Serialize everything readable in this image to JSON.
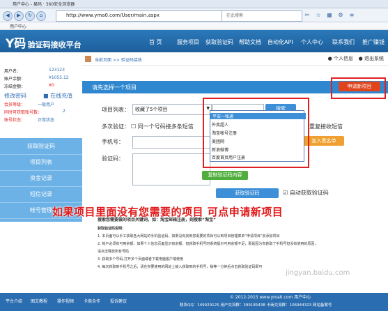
{
  "browser": {
    "tab_title": "用户中心 - 易码 · 360安全浏览器",
    "url": "http://www.yma0.com/User/main.aspx",
    "search_placeholder": "在此搜索",
    "bookmark": "用户中心"
  },
  "site": {
    "logo_main": "Y码",
    "logo_sub": "验证码接收平台",
    "nav": [
      "首 页",
      "服务项目",
      "获取验证码",
      "帮助文档",
      "自动化API",
      "个人中心",
      "联系我们",
      "推广赚钱"
    ]
  },
  "breadcrumb": {
    "text": "当前页面 >> 验证码接收",
    "userinfo": "个人信息",
    "logout": "退出系统"
  },
  "account": {
    "username_label": "用户名：",
    "username": "123123",
    "balance_label": "账户余额：",
    "balance": "¥1055.12",
    "frozen_label": "冻结金额：",
    "frozen": "¥0",
    "change_pwd": "修改密码",
    "recharge": "在线充值",
    "level_label": "会员等级：",
    "level": "一般用户",
    "concurrent_label": "同时可获取账号数：",
    "concurrent": "2",
    "status_label": "账号状态：",
    "status": "正常状态"
  },
  "sidebar_menu": [
    "获取验证码",
    "项目列表",
    "资金记录",
    "短信记录",
    "帐号管理"
  ],
  "panel": {
    "title": "请先选择一个项目",
    "apply_button": "申请新项目",
    "project_label": "项目列表：",
    "project_select": "收藏了5个项目",
    "search_button": "搜索",
    "multi_label": "多次验证：",
    "multi_text": "同一个号码接多条短信",
    "reuse_text": "重复接收短信",
    "phone_label": "手机号：",
    "blacklist_button": "加入黑名单",
    "code_label": "验证码：",
    "copy_button": "复制验证码内容",
    "get_code_button": "获取验证码",
    "auto_get_text": "自动获取验证码"
  },
  "dropdown": {
    "input_value": "",
    "items": [
      "平安一帐通",
      "外卖超人",
      "淘宝帐号注册",
      "美团网",
      "新浪微博",
      "百度首页用户注册"
    ]
  },
  "caption": "如果项目里面没有您需要的项目 可点申请新项目",
  "notes": [
    "搜索您需要做的项目关键词，如：淘宝邮箱注册，则搜索“淘宝”",
    "获取验证码说明：",
    "1. 本页面可以手工获取各大网站的手机验证码，如果没有找到您需要的项目可以到项目管理菜单“申请项目”去添加项目",
    "2. 帐户必须有可用余额，如果个人信息页面显示有余额，但获取手机号时系统提示可用余额不足，那是因为你获取了手机号但没有使用的原因，",
    "请点击释放所有号码",
    "3. 获取多个号码,打开多个页面或者下载电脑客户端使用",
    "4. 每次获取到手机号之后，请在你要使用的网站上输入获取到的手机号，稍等一分钟后点击获取验证码即可"
  ],
  "footer": {
    "links": [
      "平台介绍",
      "图文教程",
      "操作视频",
      "卡商合作",
      "投诉建议"
    ],
    "copyright": "© 2012-2015 www.yma0.com 用户中心",
    "contacts": "联系QQ：149029125 用户交流群：399185438 卡商交流群：106944323 网站备案号"
  },
  "watermark": "jingyan.baidu.com"
}
